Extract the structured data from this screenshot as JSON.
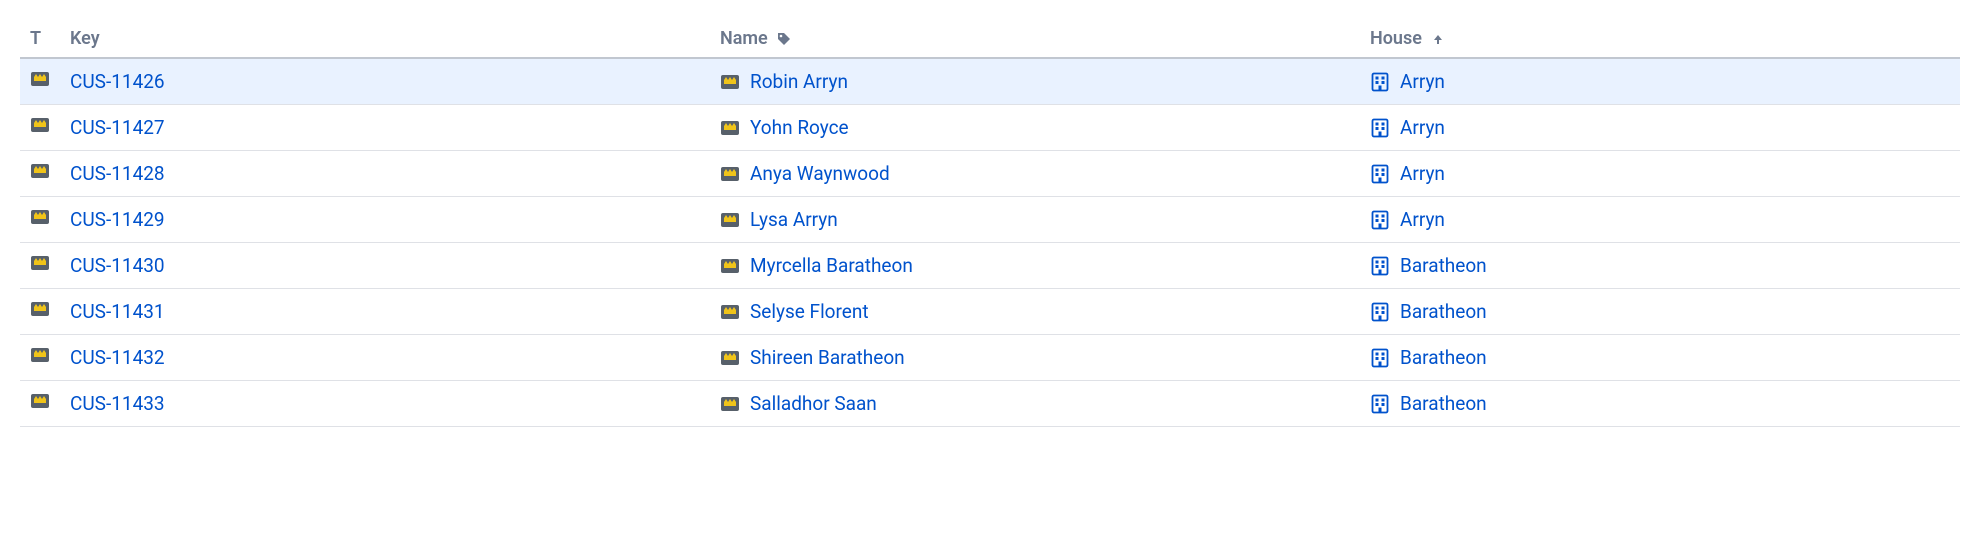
{
  "columns": {
    "type": "T",
    "key": "Key",
    "name": "Name",
    "house": "House"
  },
  "sort": {
    "column": "house",
    "dir": "asc"
  },
  "rows": [
    {
      "key": "CUS-11426",
      "name": "Robin Arryn",
      "house": "Arryn",
      "selected": true
    },
    {
      "key": "CUS-11427",
      "name": "Yohn Royce",
      "house": "Arryn",
      "selected": false
    },
    {
      "key": "CUS-11428",
      "name": "Anya Waynwood",
      "house": "Arryn",
      "selected": false
    },
    {
      "key": "CUS-11429",
      "name": "Lysa Arryn",
      "house": "Arryn",
      "selected": false
    },
    {
      "key": "CUS-11430",
      "name": "Myrcella Baratheon",
      "house": "Baratheon",
      "selected": false
    },
    {
      "key": "CUS-11431",
      "name": "Selyse Florent",
      "house": "Baratheon",
      "selected": false
    },
    {
      "key": "CUS-11432",
      "name": "Shireen Baratheon",
      "house": "Baratheon",
      "selected": false
    },
    {
      "key": "CUS-11433",
      "name": "Salladhor Saan",
      "house": "Baratheon",
      "selected": false
    }
  ]
}
